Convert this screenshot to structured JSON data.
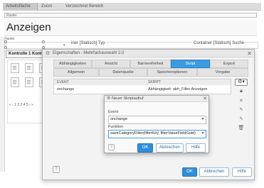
{
  "editor": {
    "tabs": [
      "Arbeitsfläche",
      "Zoom",
      "Verzeichnet Bereich"
    ],
    "search_strip": "Raster",
    "page_title": "Anzeigen",
    "raster_label": "Raster",
    "static_typ": "iner [Statisch] Typ",
    "static_suche": "Container [Statisch] Suche",
    "kontrolle": "Kontrolle 1 Kontr",
    "pager": "« ‹ 1 2 3 4 5 › »"
  },
  "properties_dialog": {
    "title": "Eigenschaften - Mehrfachauswahl 2.0",
    "tabs_row1": [
      "Abhängigkeiten",
      "Ansicht",
      "Barrierefreiheit",
      "Skript",
      "Export"
    ],
    "tabs_row2": [
      "Allgemein",
      "Datenquelle",
      "Speicheroptionen",
      "Vorgabe"
    ],
    "active_tab": "Skript",
    "table": {
      "headers": [
        "EVENT",
        "SKRIPT"
      ],
      "rows": [
        {
          "event": "onchange",
          "script": "Abhängigkeit: abh_Filter Anzeigen"
        }
      ]
    },
    "side_icons": [
      "add-icon",
      "close-icon",
      "edit-icon",
      "edit-icon",
      "delete-icon"
    ],
    "buttons": {
      "ok": "OK",
      "cancel": "Abbrechen",
      "help": "Hilfe"
    }
  },
  "new_script_dialog": {
    "title": "Neuer Skriptaufruf",
    "event_label": "Event",
    "event_value": "onchange",
    "function_label": "Funktion",
    "function_value": "saveCategoryFilter(filterKey, filterValueFieldGuid)",
    "buttons": {
      "ok": "OK",
      "cancel": "Abbrechen",
      "help": "Hilfe"
    }
  },
  "colors": {
    "accent": "#2d8fda",
    "active_tab": "#3a9be0"
  }
}
